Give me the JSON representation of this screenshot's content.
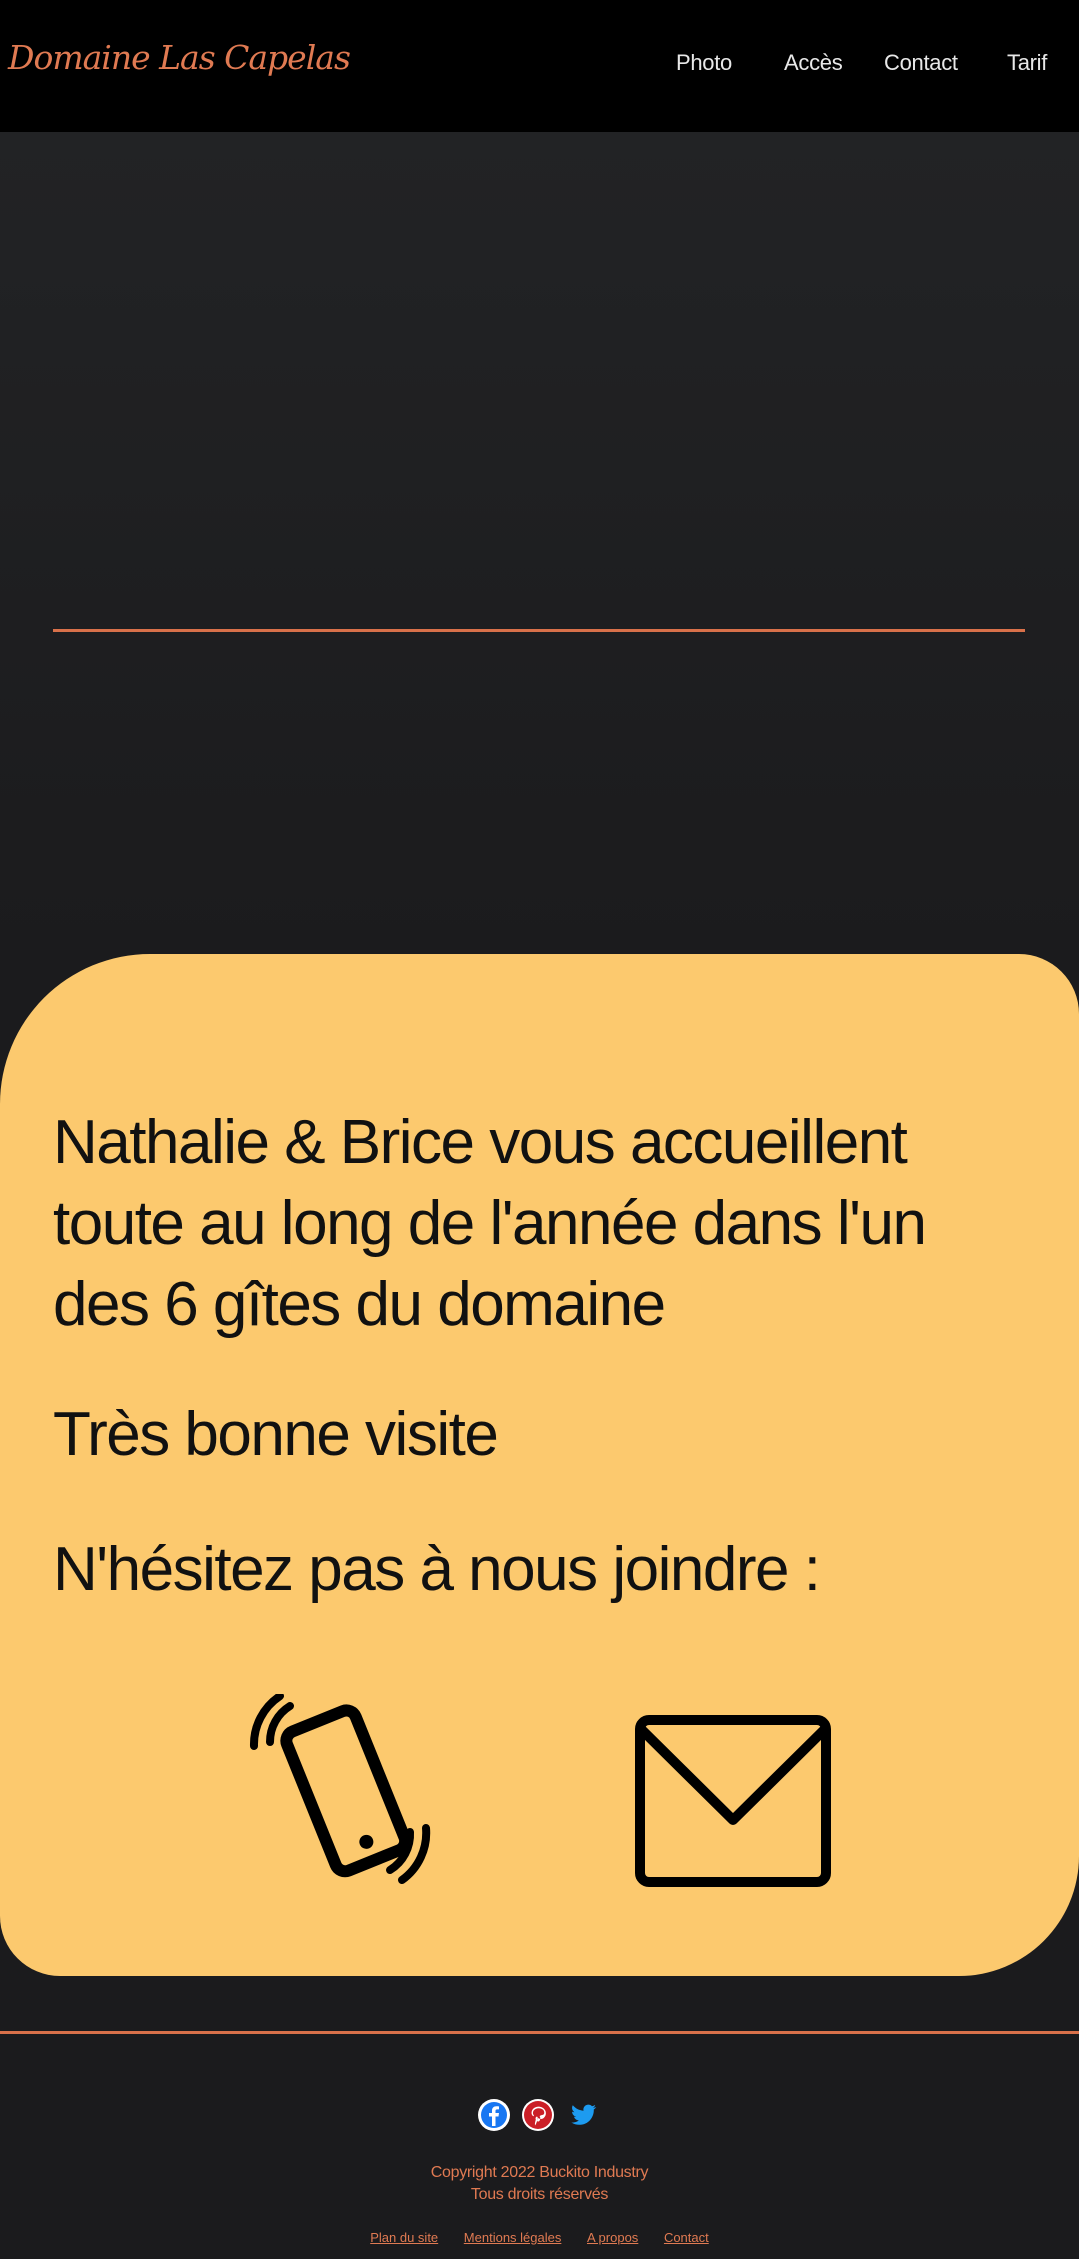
{
  "header": {
    "logo_text": "Domaine Las Capelas",
    "nav": [
      "Photo",
      "Accès",
      "Contact",
      "Tarif"
    ]
  },
  "main": {
    "welcome_text": "Nathalie & Brice vous accueillent toute au long de l'année dans l'un des 6 gîtes du domaine",
    "visit_text": "Très bonne visite",
    "join_text": "N'hésitez pas à nous joindre :",
    "contact_icons": [
      "phone-vibrating-icon",
      "mail-envelope-icon"
    ]
  },
  "footer": {
    "social_icons": [
      "facebook-icon",
      "pinterest-icon",
      "twitter-icon"
    ],
    "copyright_line1": "Copyright 2022 Buckito Industry",
    "copyright_line2": "Tous droits réservés",
    "links": [
      "Plan du site",
      "Mentions légales",
      "A propos",
      "Contact"
    ]
  },
  "colors": {
    "accent": "#e07a52",
    "card_background": "#fcc96e",
    "header_background": "#000000",
    "page_background": "#1b1b1d"
  }
}
